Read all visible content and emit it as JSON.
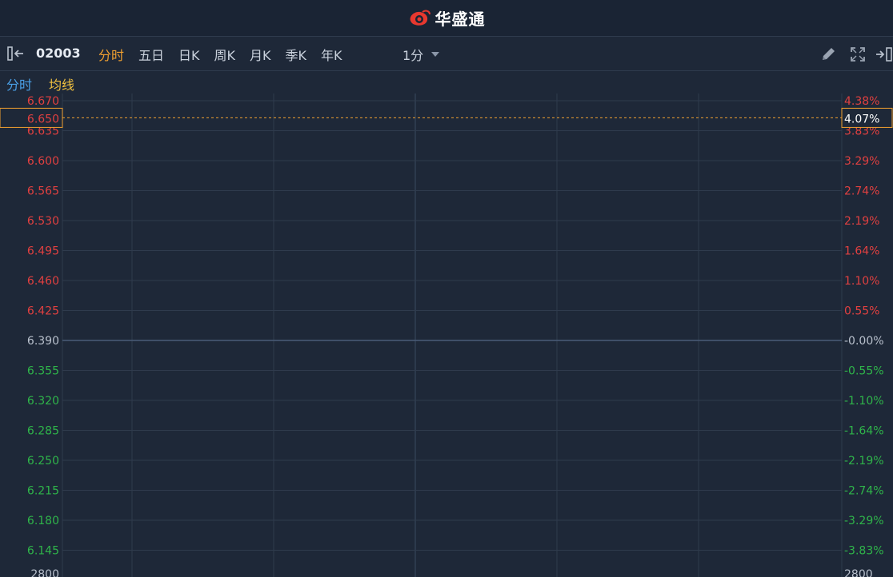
{
  "app": {
    "title": "华盛通"
  },
  "toolbar": {
    "symbol": "02003",
    "tabs": [
      {
        "label": "分时",
        "active": true
      },
      {
        "label": "五日",
        "active": false
      },
      {
        "label": "日K",
        "active": false
      },
      {
        "label": "周K",
        "active": false
      },
      {
        "label": "月K",
        "active": false
      },
      {
        "label": "季K",
        "active": false
      },
      {
        "label": "年K",
        "active": false
      }
    ],
    "interval": "1分",
    "icons": [
      "collapse-left-icon",
      "pencil-icon",
      "fullscreen-icon",
      "collapse-right-icon"
    ]
  },
  "subbar": {
    "time_label": "分时",
    "avg_label": "均线"
  },
  "colors": {
    "up": "#e04040",
    "down": "#2fb44a",
    "neutral": "#b8c0cc",
    "accent": "#f0a030",
    "grid": "#2f3b4d"
  },
  "chart_data": {
    "type": "line",
    "series": [],
    "prev_close": 6.39,
    "ylim": [
      6.145,
      6.67
    ],
    "grid": true,
    "y_ticks": [
      {
        "price": 6.67,
        "label": "6.670",
        "pct": "4.38%"
      },
      {
        "price": 6.635,
        "label": "6.635",
        "pct": "3.83%"
      },
      {
        "price": 6.6,
        "label": "6.600",
        "pct": "3.29%"
      },
      {
        "price": 6.565,
        "label": "6.565",
        "pct": "2.74%"
      },
      {
        "price": 6.53,
        "label": "6.530",
        "pct": "2.19%"
      },
      {
        "price": 6.495,
        "label": "6.495",
        "pct": "1.64%"
      },
      {
        "price": 6.46,
        "label": "6.460",
        "pct": "1.10%"
      },
      {
        "price": 6.425,
        "label": "6.425",
        "pct": "0.55%"
      },
      {
        "price": 6.39,
        "label": "6.390",
        "pct": "-0.00%"
      },
      {
        "price": 6.355,
        "label": "6.355",
        "pct": "-0.55%"
      },
      {
        "price": 6.32,
        "label": "6.320",
        "pct": "-1.10%"
      },
      {
        "price": 6.285,
        "label": "6.285",
        "pct": "-1.64%"
      },
      {
        "price": 6.25,
        "label": "6.250",
        "pct": "-2.19%"
      },
      {
        "price": 6.215,
        "label": "6.215",
        "pct": "-2.74%"
      },
      {
        "price": 6.18,
        "label": "6.180",
        "pct": "-3.29%"
      },
      {
        "price": 6.145,
        "label": "6.145",
        "pct": "-3.83%"
      }
    ],
    "volume_label": "2800",
    "volume_label_right": "2800",
    "crosshair": {
      "price": 6.65,
      "price_label": "6.650",
      "pct_label": "4.07%"
    }
  }
}
